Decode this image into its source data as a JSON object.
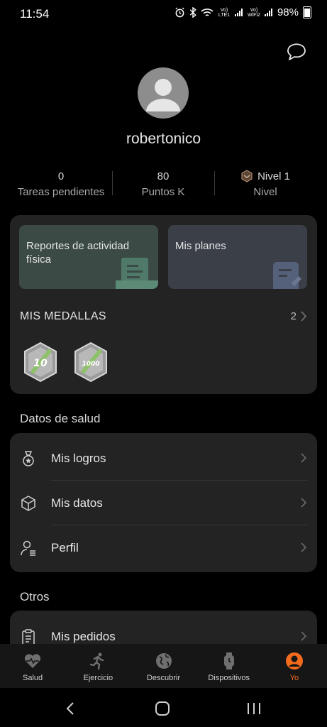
{
  "status_bar": {
    "time": "11:54",
    "battery": "98%",
    "volte1": "Vo) LTE1",
    "volte2": "Vo) WiFi2"
  },
  "profile": {
    "username": "robertonico"
  },
  "stats": [
    {
      "value": "0",
      "label": "Tareas pendientes"
    },
    {
      "value": "80",
      "label": "Puntos K"
    },
    {
      "value": "Nivel 1",
      "label": "Nivel"
    }
  ],
  "tiles": [
    {
      "label": "Reportes de actividad física"
    },
    {
      "label": "Mis planes"
    }
  ],
  "medals": {
    "title": "MIS MEDALLAS",
    "count": "2",
    "badges": [
      "10",
      "1000"
    ]
  },
  "health_section": {
    "title": "Datos de salud",
    "items": [
      {
        "label": "Mis logros",
        "icon": "medal-icon"
      },
      {
        "label": "Mis datos",
        "icon": "cube-icon"
      },
      {
        "label": "Perfil",
        "icon": "user-icon"
      }
    ]
  },
  "others_section": {
    "title": "Otros",
    "items": [
      {
        "label": "Mis pedidos",
        "icon": "clipboard-icon"
      }
    ]
  },
  "tabbar": [
    {
      "label": "Salud",
      "icon": "heart-icon"
    },
    {
      "label": "Ejercicio",
      "icon": "runner-icon"
    },
    {
      "label": "Descubrir",
      "icon": "globe-icon"
    },
    {
      "label": "Dispositivos",
      "icon": "watch-icon"
    },
    {
      "label": "Yo",
      "icon": "profile-icon",
      "active": true
    }
  ],
  "colors": {
    "accent": "#f26b1d",
    "background": "#000000",
    "card": "#232323"
  }
}
